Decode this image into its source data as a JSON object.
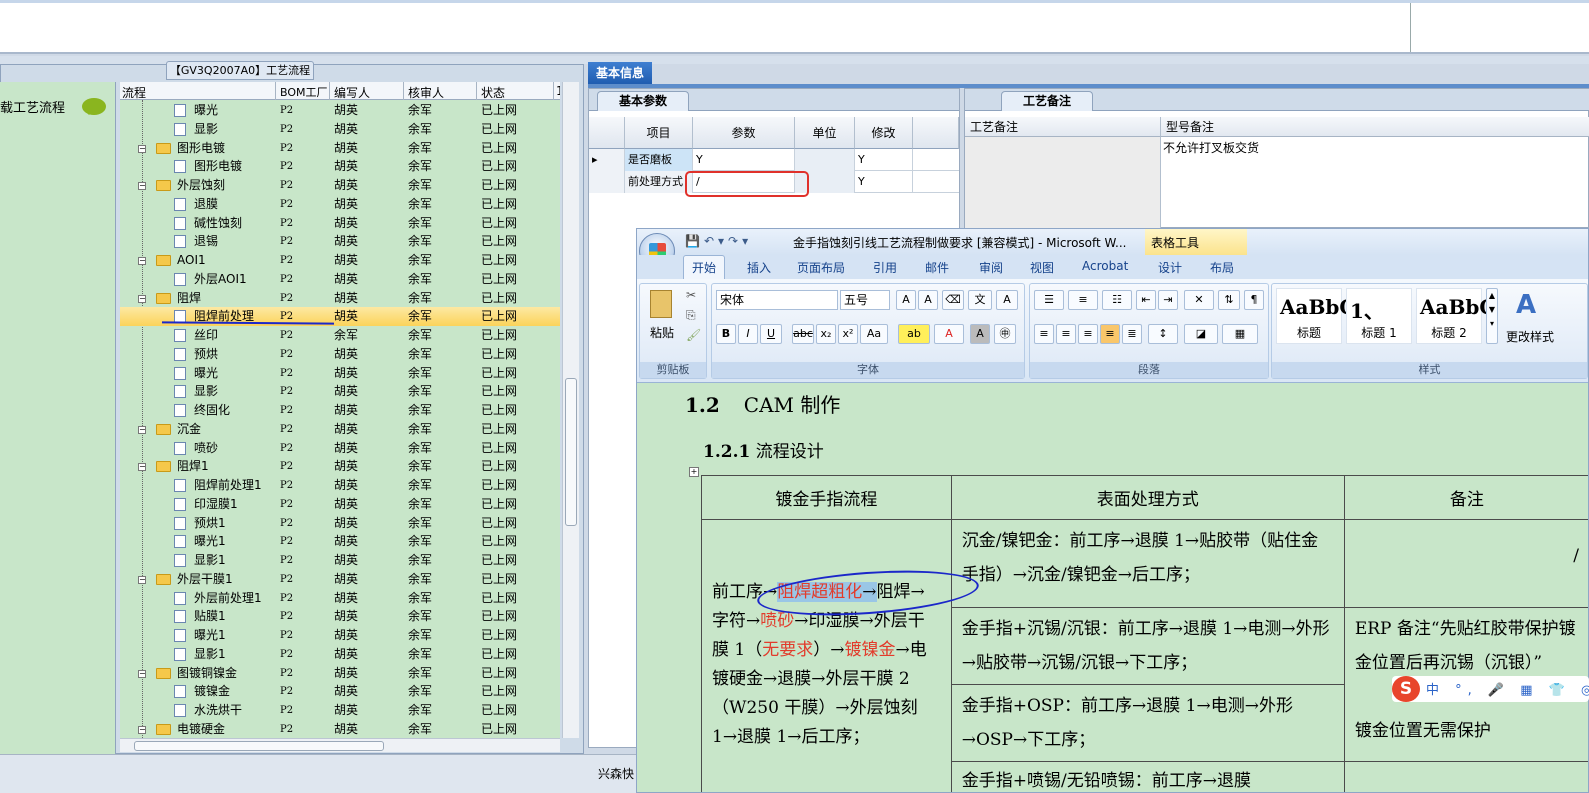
{
  "left": {
    "proc_title": "【GV3Q2007A0】工艺流程",
    "flow_item": "载工艺流程"
  },
  "tree": {
    "headers": [
      "流程",
      "BOM工厂",
      "编写人",
      "核审人",
      "状态",
      "1"
    ],
    "rows": [
      {
        "name": "曝光",
        "bom": "P2",
        "writer": "胡英",
        "reviewer": "余军",
        "status": "已上网",
        "type": "leaf"
      },
      {
        "name": "显影",
        "bom": "P2",
        "writer": "胡英",
        "reviewer": "余军",
        "status": "已上网",
        "type": "leaf"
      },
      {
        "name": "图形电镀",
        "bom": "P2",
        "writer": "胡英",
        "reviewer": "余军",
        "status": "已上网",
        "type": "folder"
      },
      {
        "name": "图形电镀",
        "bom": "P2",
        "writer": "胡英",
        "reviewer": "余军",
        "status": "已上网",
        "type": "leaf"
      },
      {
        "name": "外层蚀刻",
        "bom": "P2",
        "writer": "胡英",
        "reviewer": "余军",
        "status": "已上网",
        "type": "folder"
      },
      {
        "name": "退膜",
        "bom": "P2",
        "writer": "胡英",
        "reviewer": "余军",
        "status": "已上网",
        "type": "leaf"
      },
      {
        "name": "碱性蚀刻",
        "bom": "P2",
        "writer": "胡英",
        "reviewer": "余军",
        "status": "已上网",
        "type": "leaf"
      },
      {
        "name": "退锡",
        "bom": "P2",
        "writer": "胡英",
        "reviewer": "余军",
        "status": "已上网",
        "type": "leaf"
      },
      {
        "name": "AOI1",
        "bom": "P2",
        "writer": "胡英",
        "reviewer": "余军",
        "status": "已上网",
        "type": "folder"
      },
      {
        "name": "外层AOI1",
        "bom": "P2",
        "writer": "胡英",
        "reviewer": "余军",
        "status": "已上网",
        "type": "leaf"
      },
      {
        "name": "阻焊",
        "bom": "P2",
        "writer": "胡英",
        "reviewer": "余军",
        "status": "已上网",
        "type": "folder"
      },
      {
        "name": "阻焊前处理",
        "bom": "P2",
        "writer": "胡英",
        "reviewer": "余军",
        "status": "已上网",
        "type": "leaf",
        "selected": true
      },
      {
        "name": "丝印",
        "bom": "P2",
        "writer": "余军",
        "reviewer": "余军",
        "status": "已上网",
        "type": "leaf"
      },
      {
        "name": "预烘",
        "bom": "P2",
        "writer": "胡英",
        "reviewer": "余军",
        "status": "已上网",
        "type": "leaf"
      },
      {
        "name": "曝光",
        "bom": "P2",
        "writer": "胡英",
        "reviewer": "余军",
        "status": "已上网",
        "type": "leaf"
      },
      {
        "name": "显影",
        "bom": "P2",
        "writer": "胡英",
        "reviewer": "余军",
        "status": "已上网",
        "type": "leaf"
      },
      {
        "name": "终固化",
        "bom": "P2",
        "writer": "胡英",
        "reviewer": "余军",
        "status": "已上网",
        "type": "leaf"
      },
      {
        "name": "沉金",
        "bom": "P2",
        "writer": "胡英",
        "reviewer": "余军",
        "status": "已上网",
        "type": "folder"
      },
      {
        "name": "喷砂",
        "bom": "P2",
        "writer": "胡英",
        "reviewer": "余军",
        "status": "已上网",
        "type": "leaf"
      },
      {
        "name": "阻焊1",
        "bom": "P2",
        "writer": "胡英",
        "reviewer": "余军",
        "status": "已上网",
        "type": "folder"
      },
      {
        "name": "阻焊前处理1",
        "bom": "P2",
        "writer": "胡英",
        "reviewer": "余军",
        "status": "已上网",
        "type": "leaf"
      },
      {
        "name": "印湿膜1",
        "bom": "P2",
        "writer": "胡英",
        "reviewer": "余军",
        "status": "已上网",
        "type": "leaf"
      },
      {
        "name": "预烘1",
        "bom": "P2",
        "writer": "胡英",
        "reviewer": "余军",
        "status": "已上网",
        "type": "leaf"
      },
      {
        "name": "曝光1",
        "bom": "P2",
        "writer": "胡英",
        "reviewer": "余军",
        "status": "已上网",
        "type": "leaf"
      },
      {
        "name": "显影1",
        "bom": "P2",
        "writer": "胡英",
        "reviewer": "余军",
        "status": "已上网",
        "type": "leaf"
      },
      {
        "name": "外层干膜1",
        "bom": "P2",
        "writer": "胡英",
        "reviewer": "余军",
        "status": "已上网",
        "type": "folder"
      },
      {
        "name": "外层前处理1",
        "bom": "P2",
        "writer": "胡英",
        "reviewer": "余军",
        "status": "已上网",
        "type": "leaf"
      },
      {
        "name": "贴膜1",
        "bom": "P2",
        "writer": "胡英",
        "reviewer": "余军",
        "status": "已上网",
        "type": "leaf"
      },
      {
        "name": "曝光1",
        "bom": "P2",
        "writer": "胡英",
        "reviewer": "余军",
        "status": "已上网",
        "type": "leaf"
      },
      {
        "name": "显影1",
        "bom": "P2",
        "writer": "胡英",
        "reviewer": "余军",
        "status": "已上网",
        "type": "leaf"
      },
      {
        "name": "图镀铜镍金",
        "bom": "P2",
        "writer": "胡英",
        "reviewer": "余军",
        "status": "已上网",
        "type": "folder"
      },
      {
        "name": "镀镍金",
        "bom": "P2",
        "writer": "胡英",
        "reviewer": "余军",
        "status": "已上网",
        "type": "leaf"
      },
      {
        "name": "水洗烘干",
        "bom": "P2",
        "writer": "胡英",
        "reviewer": "余军",
        "status": "已上网",
        "type": "leaf"
      },
      {
        "name": "电镀硬金",
        "bom": "P2",
        "writer": "胡英",
        "reviewer": "余军",
        "status": "已上网",
        "type": "folder"
      }
    ]
  },
  "status_text": "兴森快",
  "info": {
    "tab": "基本信息",
    "basic_tab": "基本参数",
    "grid_headers": [
      "项目",
      "参数",
      "单位",
      "修改"
    ],
    "grid_rows": [
      {
        "item": "是否磨板",
        "param": "Y",
        "unit": "",
        "mod": "Y"
      },
      {
        "item": "前处理方式",
        "param": "/",
        "unit": "",
        "mod": "Y"
      }
    ],
    "memo_tab": "工艺备注",
    "memo_headers": [
      "工艺备注",
      "型号备注"
    ],
    "memo_text": "不允许打叉板交货"
  },
  "word": {
    "title": "金手指蚀刻引线工艺流程制做要求 [兼容模式] - Microsoft W...",
    "context_tab": "表格工具",
    "tabs": [
      "开始",
      "插入",
      "页面布局",
      "引用",
      "邮件",
      "审阅",
      "视图",
      "Acrobat",
      "设计",
      "布局"
    ],
    "groups": {
      "clipboard": "剪贴板",
      "font": "字体",
      "paragraph": "段落",
      "styles": "样式"
    },
    "paste": "粘贴",
    "font_name": "宋体",
    "font_size": "五号",
    "change_styles": "更改样式",
    "styles": [
      {
        "sample": "AaBbC",
        "name": "标题"
      },
      {
        "sample": "1、",
        "name": "标题 1"
      },
      {
        "sample": "AaBbC",
        "name": "标题 2"
      }
    ],
    "doc": {
      "h1_num": "1.2",
      "h1": "CAM 制作",
      "h2_num": "1.2.1",
      "h2": "流程设计",
      "table_headers": [
        "镀金手指流程",
        "表面处理方式",
        "备注"
      ],
      "flow": {
        "p1": "前工序→",
        "p2": "阻焊超粗化",
        "p3": "→",
        "p4": "阻焊→字符→",
        "p5": "喷砂",
        "p6": "→印湿膜→外层干膜 1（",
        "p7": "无要求",
        "p8": "）→",
        "p9": "镀镍金",
        "p10": "→电镀硬金→退膜→外层干膜 2（W250 干膜）→外层蚀刻 1→退膜 1→后工序；"
      },
      "surf": [
        "沉金/镍钯金：前工序→退膜 1→贴胶带（贴住金手指）→沉金/镍钯金→后工序；",
        "金手指+沉锡/沉银：前工序→退膜 1→电测→外形→贴胶带→沉锡/沉银→下工序；",
        "金手指+OSP：前工序→退膜 1→电测→外形→OSP→下工序；",
        "金手指+喷锡/无铅喷锡：前工序→退膜"
      ],
      "note": [
        "/",
        "ERP 备注“先贴红胶带保护镀金位置后再沉锡（沉银）”",
        "镀金位置无需保护"
      ]
    }
  },
  "ime": {
    "logo": "S",
    "text": "中 °, 🎤 ▦ 👕 ◎"
  }
}
